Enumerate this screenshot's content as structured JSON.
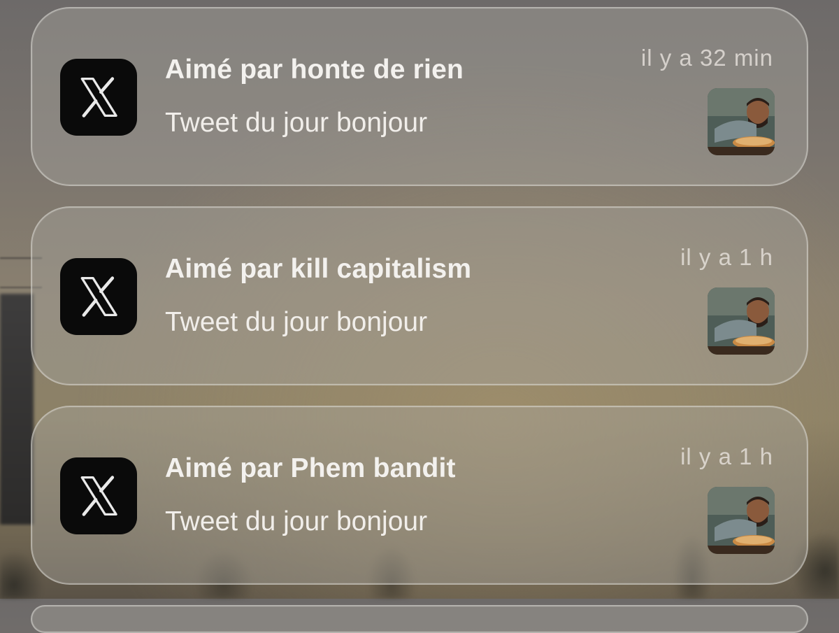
{
  "notifications": [
    {
      "app": "X",
      "icon": "x-logo-icon",
      "title": "Aimé par honte de rien",
      "body": "Tweet du jour bonjour",
      "time": "il y a 32 min",
      "thumbnail": "tweet-image-thumbnail"
    },
    {
      "app": "X",
      "icon": "x-logo-icon",
      "title": "Aimé par kill capitalism",
      "body": "Tweet du jour bonjour",
      "time": "il y a 1 h",
      "thumbnail": "tweet-image-thumbnail"
    },
    {
      "app": "X",
      "icon": "x-logo-icon",
      "title": "Aimé par Phem bandit",
      "body": "Tweet du jour bonjour",
      "time": "il y a 1 h",
      "thumbnail": "tweet-image-thumbnail"
    }
  ],
  "colors": {
    "card_background": "#a8a49e",
    "text_primary": "#f3f1ee",
    "icon_background": "#0a0a0a"
  }
}
